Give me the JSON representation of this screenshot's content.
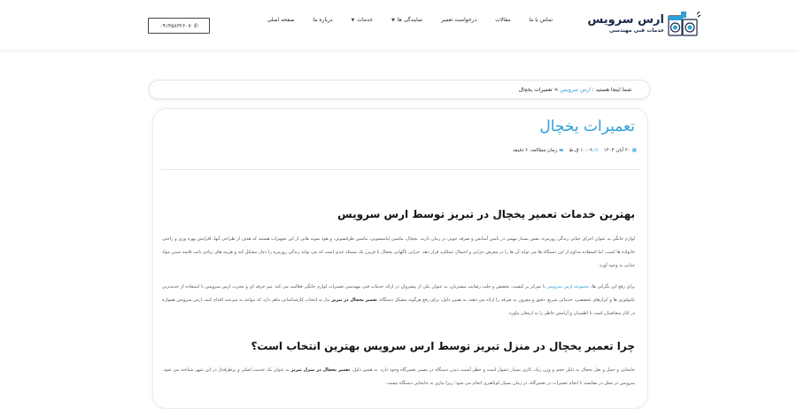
{
  "header": {
    "logo_title": "ارس سرویس",
    "logo_sub": "خدمات فنی مهندسی",
    "nav": [
      {
        "label": "صفحه اصلی",
        "dropdown": false
      },
      {
        "label": "درباره ما",
        "dropdown": false
      },
      {
        "label": "خدمات",
        "dropdown": true
      },
      {
        "label": "نمایندگی ها",
        "dropdown": true
      },
      {
        "label": "درخواست تعمیر",
        "dropdown": false
      },
      {
        "label": "مقالات",
        "dropdown": false
      },
      {
        "label": "تماس با ما",
        "dropdown": false
      }
    ],
    "phone": "۰۹۱۴۵۸۳۲۶۰۷"
  },
  "breadcrumb": {
    "prefix": "شما اینجا هستید :",
    "home": "ارس سرویس",
    "sep": ">",
    "current": "تعمیرات یخچال"
  },
  "article": {
    "title": "تعمیرات یخچال",
    "date": "۲۰ آبان ۱۴۰۴",
    "time": "۱۰:۰۹ ق.ظ",
    "read_time": "زمان مطالعه: ۶ دقیقه",
    "h2_1": "بهترین خدمات تعمیر یخچال در تبریز توسط ارس سرویس",
    "p1": "لوازم خانگی به عنوان اجزای حیاتی زندگی روزمره، نقش بسیار مهمی در تامین آسایش و صرفه جویی در زمان دارند. یخچال، ماشین لباسشویی، ماشین ظرفشویی، و هود نمونه هایی از این تجهیزات هستند که هدف از طراحی آنها، افزایش بهره وری و راحتی خانواده ها است. اما استفاده مداوم از این دستگاه ها می تواند آن ها را در معرض خرابی و احتمال عملکرد قرار دهد. خرابی ناگهانی یخچال یا فریزر یک مسئله جدی است که می تواند زندگی روزمره را دچار مشکل کند و هزینه های زیادی بابت فاسد شدن مواد غذایی به وجود آورد.",
    "p2_a": "برای رفع این نگرانی ها،",
    "p2_link": "مجموعه ارس سرویس",
    "p2_b": "با تمرکز بر کیفیت، تخصص و جلب رضایت مشتریان، به عنوان یکی از پیشروان در ارائه خدمات فنی مهندسی تعمیرات لوازم خانگی فعالیت می کند. تیم حرفه ای و مجرب ارس سرویس با استفاده از جدیدترین تکنولوژی ها و ابزارهای تخصصی، خدماتی سریع، دقیق و مقرون به صرفه را ارائه می دهند. به همین دلیل، برای رفع هرگونه مشکل دستگاه،",
    "p2_bold": "تعمیر یخچال در تبریز",
    "p2_c": "نیاز به انتخاب کارشناسانی ماهر دارد که بتوانند به سرعت اقدام کنند. ارس سرویس همواره در کنار متقاضیان است تا اطمینان و آرامش خاطر را به ارمغان بیاورد.",
    "h2_2": "چرا تعمیر یخچال در منزل تبریز توسط ارس سرویس بهترین انتخاب است؟",
    "p3_a": "جابجایی و حمل و نقل یخچال به دلیل حجم و وزن زیاد، کاری بسیار دشوار است و خطر آسیب دیدن دستگاه در مسیر تعمیرگاه وجود دارد. به همین دلیل،",
    "p3_bold": "تعمیر یخچال در منزل تبریز",
    "p3_b": "به عنوان یک خدمت اصلی و پرطرفدار در این شهر شناخته می شود. سرویس در محل در مقایسه با انجام تعمیرات در تعمیرگاه، در زمان بسیار کوتاهتری انجام می شود؛ زیرا نیازی به جابجایی دستگاه نیست."
  },
  "colors": {
    "accent": "#2f9fd8",
    "heading": "#111111",
    "logo": "#1b2a4a"
  }
}
